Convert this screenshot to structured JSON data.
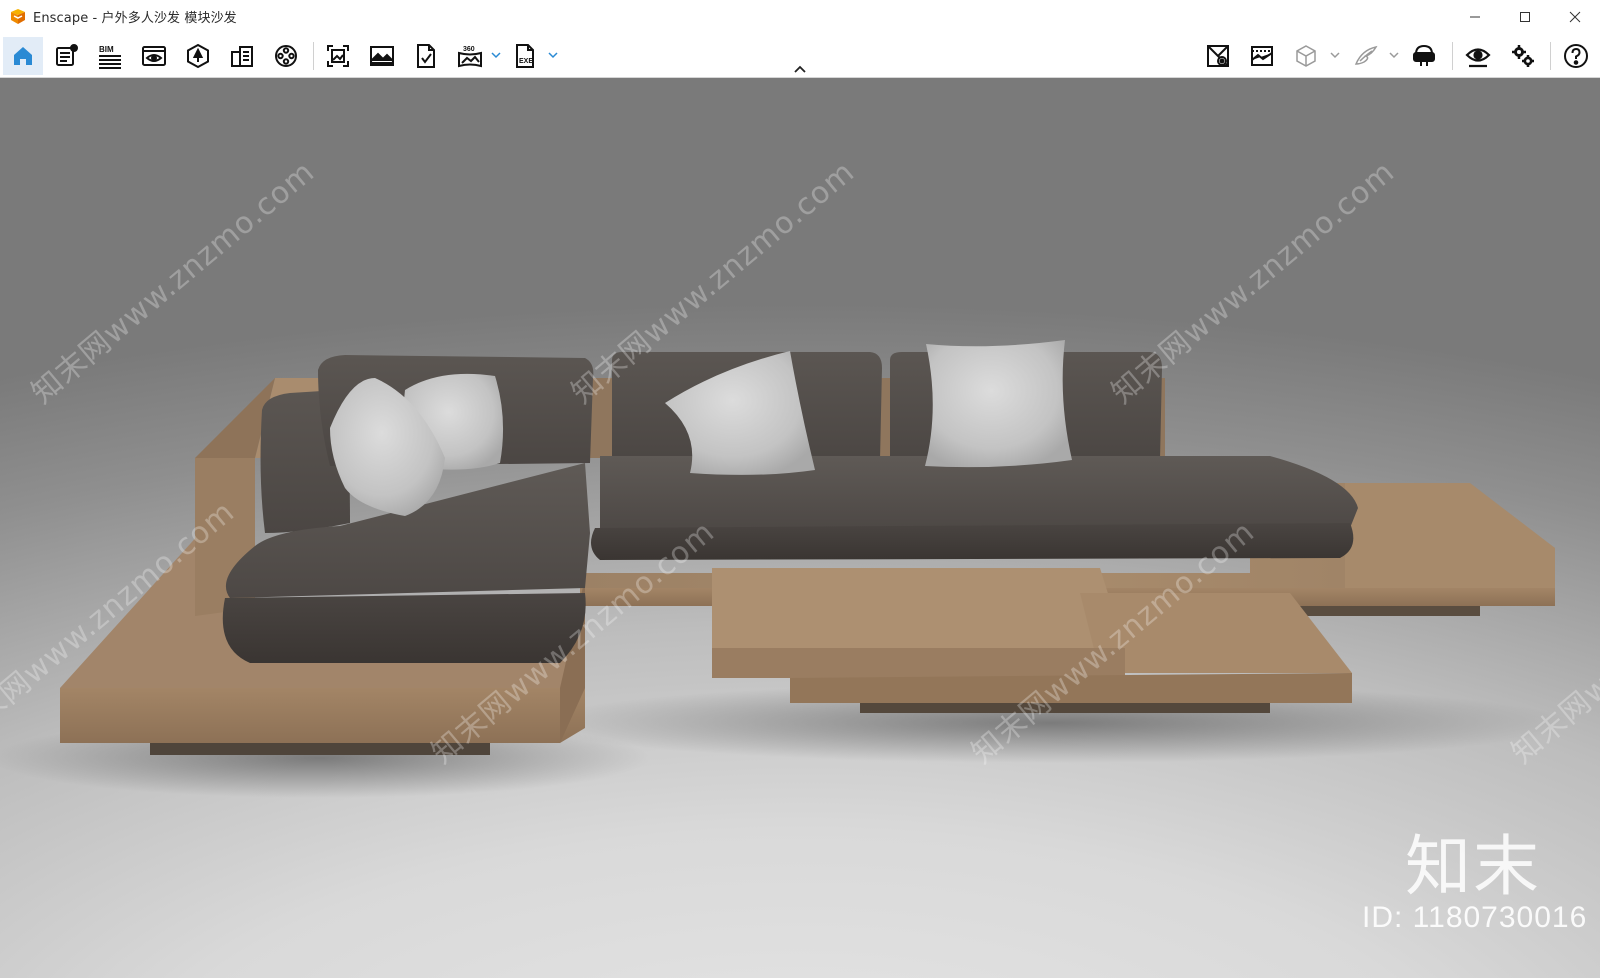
{
  "window": {
    "app_name": "Enscape",
    "title": "Enscape - 户外多人沙发 模块沙发",
    "controls": [
      "minimize-icon",
      "maximize-icon",
      "close-icon"
    ]
  },
  "toolbar": {
    "left_tools": [
      {
        "name": "home",
        "icon": "home-icon",
        "active": true
      },
      {
        "name": "sketch-settings",
        "icon": "document-settings-icon"
      },
      {
        "name": "bim",
        "icon": "bim-icon",
        "label": "BIM"
      },
      {
        "name": "views",
        "icon": "eye-window-icon"
      },
      {
        "name": "site-context",
        "icon": "tree-hexagon-icon"
      },
      {
        "name": "asset-library",
        "icon": "buildings-icon"
      },
      {
        "name": "video-editor",
        "icon": "film-reel-icon"
      },
      {
        "name": "screenshot",
        "icon": "capture-frame-icon"
      },
      {
        "name": "batch-rendering",
        "icon": "picture-icon"
      },
      {
        "name": "export-file",
        "icon": "file-export-icon"
      },
      {
        "name": "panorama",
        "icon": "panorama-360-icon",
        "label": "360"
      },
      {
        "name": "export-exe",
        "icon": "exe-file-icon",
        "label": "EXE"
      }
    ],
    "right_tools": [
      {
        "name": "material-editor",
        "icon": "material-map-icon"
      },
      {
        "name": "atmosphere",
        "icon": "atmosphere-icon"
      },
      {
        "name": "view-mode",
        "icon": "cube-icon"
      },
      {
        "name": "wings",
        "icon": "wings-icon"
      },
      {
        "name": "vr-headset",
        "icon": "vr-headset-icon"
      },
      {
        "name": "visual-settings",
        "icon": "eye-icon"
      },
      {
        "name": "settings",
        "icon": "gears-icon"
      },
      {
        "name": "help",
        "icon": "help-icon"
      }
    ],
    "accent_color": "#2a8ad4"
  },
  "viewport": {
    "watermark_text": "知末网www.znzmo.com",
    "brand_text": "知末",
    "image_id": "ID: 1180730016"
  }
}
